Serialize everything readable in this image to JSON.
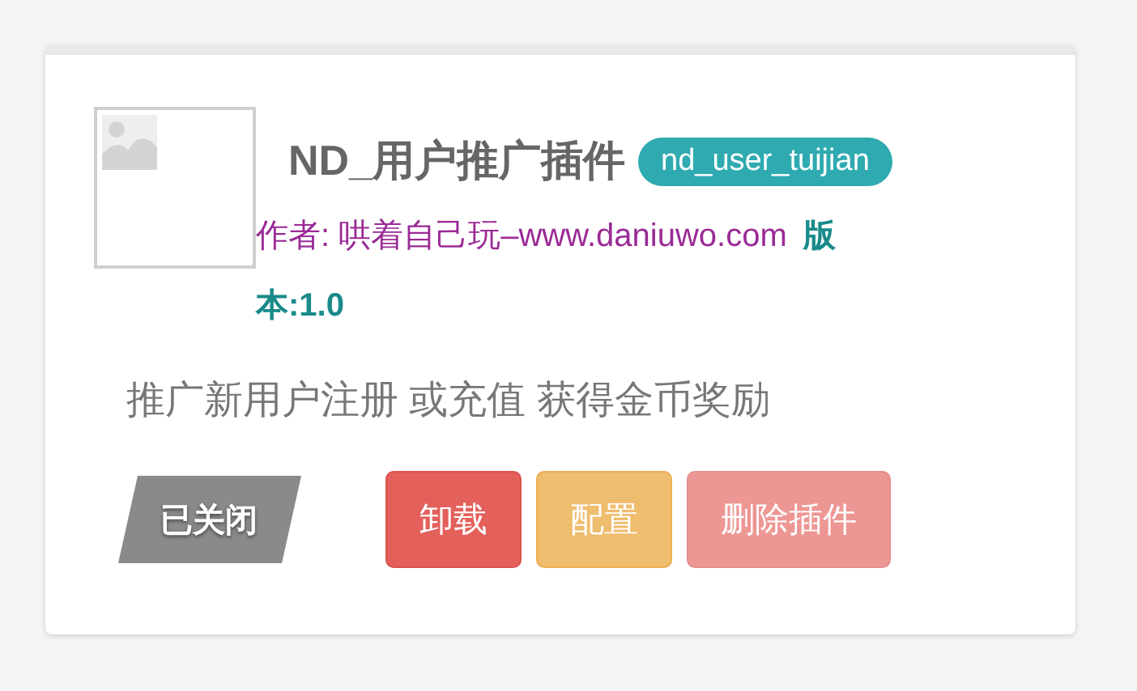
{
  "plugin": {
    "title": "ND_用户推广插件",
    "identifier": "nd_user_tuijian",
    "author": "作者: 哄着自己玩–www.daniuwo.com",
    "version": "版本:1.0",
    "description": "推广新用户注册 或充值 获得金币奖励",
    "status": {
      "kind": "closed",
      "label": "已关闭"
    },
    "buttons": [
      {
        "kind": "danger",
        "label": "卸载",
        "disabled": false
      },
      {
        "kind": "warning",
        "label": "配置",
        "disabled": false
      },
      {
        "kind": "danger",
        "label": "删除插件",
        "disabled": true
      }
    ]
  }
}
